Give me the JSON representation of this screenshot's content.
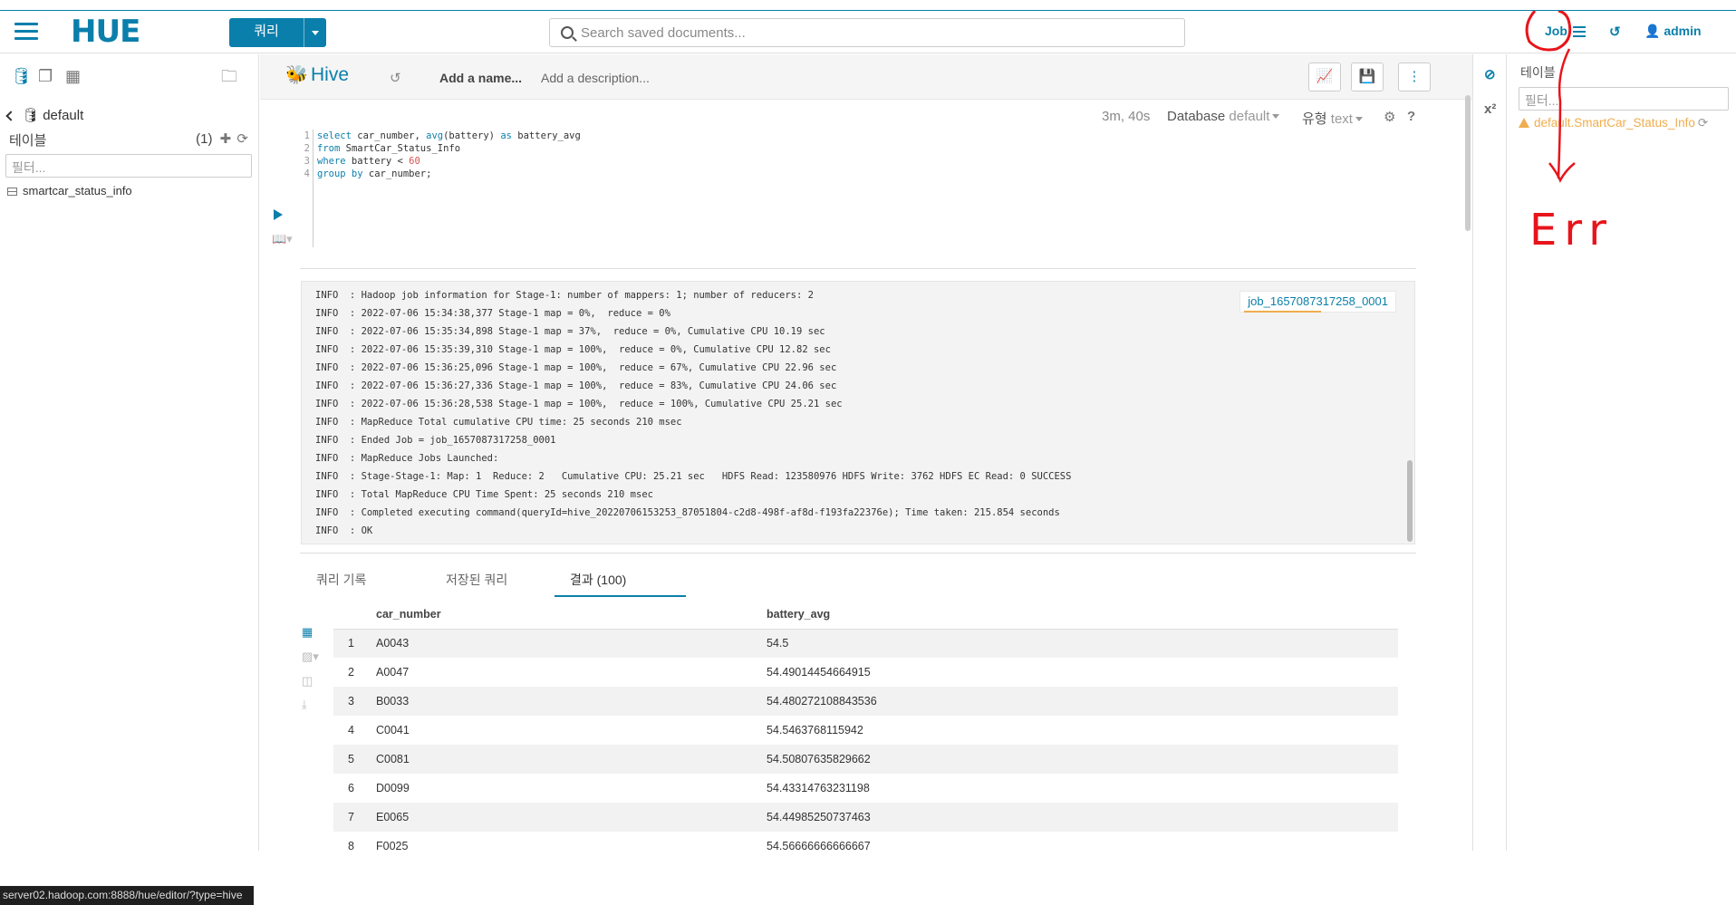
{
  "app": {
    "logo": "HUE",
    "query_button": "쿼리"
  },
  "search": {
    "placeholder": "Search saved documents..."
  },
  "nav": {
    "job_label": "Job",
    "admin_label": "admin"
  },
  "left_panel": {
    "database": "default",
    "tables_label": "테이블",
    "tables_count": "(1)",
    "filter_placeholder": "필터...",
    "table_items": [
      "smartcar_status_info"
    ]
  },
  "status_url": "server02.hadoop.com:8888/hue/editor/?type=hive",
  "editor": {
    "type_title": "Hive",
    "name_placeholder": "Add a name...",
    "description_placeholder": "Add a description...",
    "elapsed": "3m, 40s",
    "database_label": "Database",
    "database_value": "default",
    "type_label": "유형",
    "type_value": "text",
    "line_numbers": [
      "1",
      "2",
      "3",
      "4"
    ]
  },
  "log": {
    "job_id": "job_1657087317258_0001",
    "lines": [
      "INFO  : Hadoop job information for Stage-1: number of mappers: 1; number of reducers: 2",
      "INFO  : 2022-07-06 15:34:38,377 Stage-1 map = 0%,  reduce = 0%",
      "INFO  : 2022-07-06 15:35:34,898 Stage-1 map = 37%,  reduce = 0%, Cumulative CPU 10.19 sec",
      "INFO  : 2022-07-06 15:35:39,310 Stage-1 map = 100%,  reduce = 0%, Cumulative CPU 12.82 sec",
      "INFO  : 2022-07-06 15:36:25,096 Stage-1 map = 100%,  reduce = 67%, Cumulative CPU 22.96 sec",
      "INFO  : 2022-07-06 15:36:27,336 Stage-1 map = 100%,  reduce = 83%, Cumulative CPU 24.06 sec",
      "INFO  : 2022-07-06 15:36:28,538 Stage-1 map = 100%,  reduce = 100%, Cumulative CPU 25.21 sec",
      "INFO  : MapReduce Total cumulative CPU time: 25 seconds 210 msec",
      "INFO  : Ended Job = job_1657087317258_0001",
      "INFO  : MapReduce Jobs Launched:",
      "INFO  : Stage-Stage-1: Map: 1  Reduce: 2   Cumulative CPU: 25.21 sec   HDFS Read: 123580976 HDFS Write: 3762 HDFS EC Read: 0 SUCCESS",
      "INFO  : Total MapReduce CPU Time Spent: 25 seconds 210 msec",
      "INFO  : Completed executing command(queryId=hive_20220706153253_87051804-c2d8-498f-af8d-f193fa22376e); Time taken: 215.854 seconds",
      "INFO  : OK"
    ]
  },
  "tabs": {
    "history": "쿼리 기록",
    "saved": "저장된 쿼리",
    "results": "결과 (100)"
  },
  "results": {
    "columns": [
      "car_number",
      "battery_avg"
    ],
    "rows": [
      [
        "1",
        "A0043",
        "54.5"
      ],
      [
        "2",
        "A0047",
        "54.49014454664915"
      ],
      [
        "3",
        "B0033",
        "54.480272108843536"
      ],
      [
        "4",
        "C0041",
        "54.5463768115942"
      ],
      [
        "5",
        "C0081",
        "54.50807635829662"
      ],
      [
        "6",
        "D0099",
        "54.43314763231198"
      ],
      [
        "7",
        "E0065",
        "54.44985250737463"
      ],
      [
        "8",
        "F0025",
        "54.56666666666667"
      ]
    ]
  },
  "right_panel": {
    "title": "테이블",
    "filter_placeholder": "필터...",
    "item": "default.SmartCar_Status_Info"
  },
  "annotation_text": "Err",
  "colors": {
    "accent": "#0b7fab",
    "warning": "#f0ad4e",
    "annotation": "#e8141b"
  }
}
